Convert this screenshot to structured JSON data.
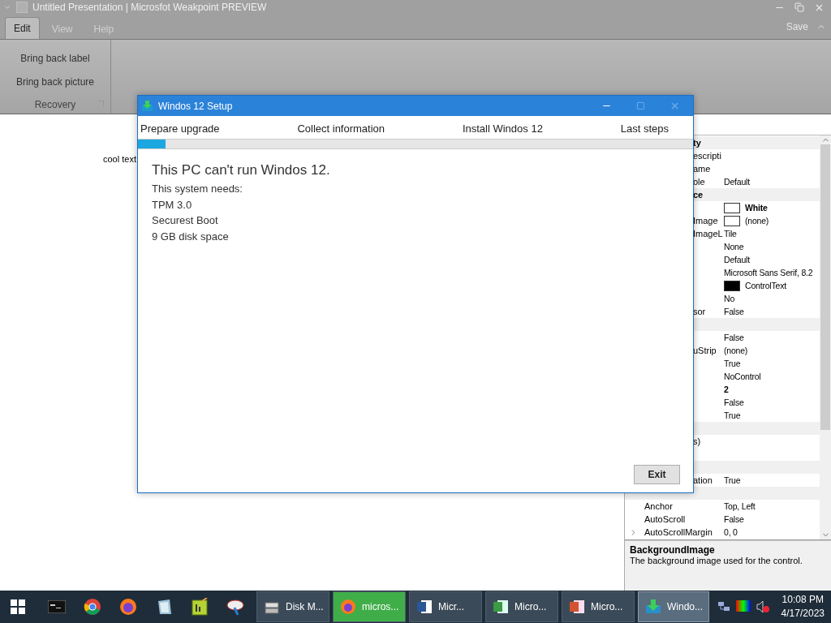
{
  "app_window": {
    "title": "Untitled Presentation | Microsfot Weakpoint PREVIEW"
  },
  "ribbon": {
    "tabs": [
      {
        "label": "Edit",
        "selected": true
      },
      {
        "label": "View",
        "selected": false
      },
      {
        "label": "Help",
        "selected": false
      }
    ],
    "save": "Save",
    "groups": [
      {
        "label": "Recovery",
        "buttons": [
          "Bring back label",
          "Bring back picture"
        ]
      }
    ]
  },
  "canvas": {
    "label": "cool text"
  },
  "property_grid": {
    "rows_behind_dialog": [
      {
        "kind": "category",
        "name": "ty"
      },
      {
        "kind": "property",
        "name": "escripti"
      },
      {
        "kind": "property",
        "name": "ame"
      },
      {
        "kind": "property",
        "name": "ole",
        "value": "Default",
        "modified": false
      },
      {
        "kind": "category",
        "name": "ce"
      },
      {
        "kind": "property",
        "value": "White",
        "color": "#ffffff",
        "modified": true
      },
      {
        "kind": "property",
        "name": "Image",
        "value": "(none)",
        "color": "#ffffff",
        "modified": false
      },
      {
        "kind": "property",
        "name": "ImageL",
        "value": "Tile",
        "modified": false
      },
      {
        "kind": "property",
        "value": "None",
        "modified": false
      },
      {
        "kind": "property",
        "value": "Default",
        "modified": false
      },
      {
        "kind": "property",
        "value": "Microsoft Sans Serif, 8.2",
        "modified": false
      },
      {
        "kind": "property",
        "value": "ControlText",
        "color": "#000000",
        "modified": false
      },
      {
        "kind": "property",
        "value": "No",
        "modified": false
      },
      {
        "kind": "property",
        "name": "sor",
        "value": "False",
        "modified": false
      },
      {
        "kind": "category"
      },
      {
        "kind": "property",
        "value": "False",
        "modified": false
      },
      {
        "kind": "property",
        "name": "uStrip",
        "value": "(none)",
        "modified": false
      },
      {
        "kind": "property",
        "value": "True",
        "modified": false
      },
      {
        "kind": "property",
        "value": "NoControl",
        "modified": false
      },
      {
        "kind": "property",
        "value": "2",
        "modified": true
      },
      {
        "kind": "property",
        "value": "False",
        "modified": false
      },
      {
        "kind": "property",
        "value": "True",
        "modified": false
      },
      {
        "kind": "category"
      },
      {
        "kind": "property",
        "name": "s)"
      },
      {
        "kind": "property"
      },
      {
        "kind": "category"
      },
      {
        "kind": "property",
        "name": "ation",
        "value": "True",
        "modified": false
      }
    ],
    "rows": [
      {
        "kind": "category"
      },
      {
        "kind": "property",
        "name": "Anchor",
        "value": "Top, Left",
        "modified": false
      },
      {
        "kind": "property",
        "name": "AutoScroll",
        "value": "False",
        "modified": false
      },
      {
        "kind": "property",
        "name": "AutoScrollMargin",
        "value": "0, 0",
        "modified": false,
        "expandable": true
      }
    ],
    "description": {
      "title": "BackgroundImage",
      "text": "The background image used for the control."
    }
  },
  "setup_dialog": {
    "title": "Windos 12 Setup",
    "steps": [
      "Prepare upgrade",
      "Collect information",
      "Install Windos 12",
      "Last steps"
    ],
    "progress": {
      "level": 0.05
    },
    "heading": "This PC can't run Windos 12.",
    "lines": [
      "This system needs:",
      "TPM 3.0",
      "Securest Boot",
      "9 GB disk space"
    ],
    "button": "Exit"
  },
  "taskbar": {
    "pinned": [
      {
        "kind": "terminal"
      },
      {
        "kind": "chrome"
      },
      {
        "kind": "firefox"
      },
      {
        "kind": "notes"
      },
      {
        "kind": "chart"
      },
      {
        "kind": "paint"
      }
    ],
    "apps": [
      {
        "label": "Disk M...",
        "selected": false,
        "flashing": false
      },
      {
        "label": "micros...",
        "selected": false,
        "flashing": true
      },
      {
        "label": "Micr...",
        "selected": false,
        "flashing": false
      },
      {
        "label": "Micro...",
        "selected": false,
        "flashing": false
      },
      {
        "label": "Micro...",
        "selected": false,
        "flashing": false
      },
      {
        "label": "Windo...",
        "selected": true,
        "flashing": false
      }
    ],
    "time": "10:08 PM",
    "date": "4/17/2023"
  }
}
